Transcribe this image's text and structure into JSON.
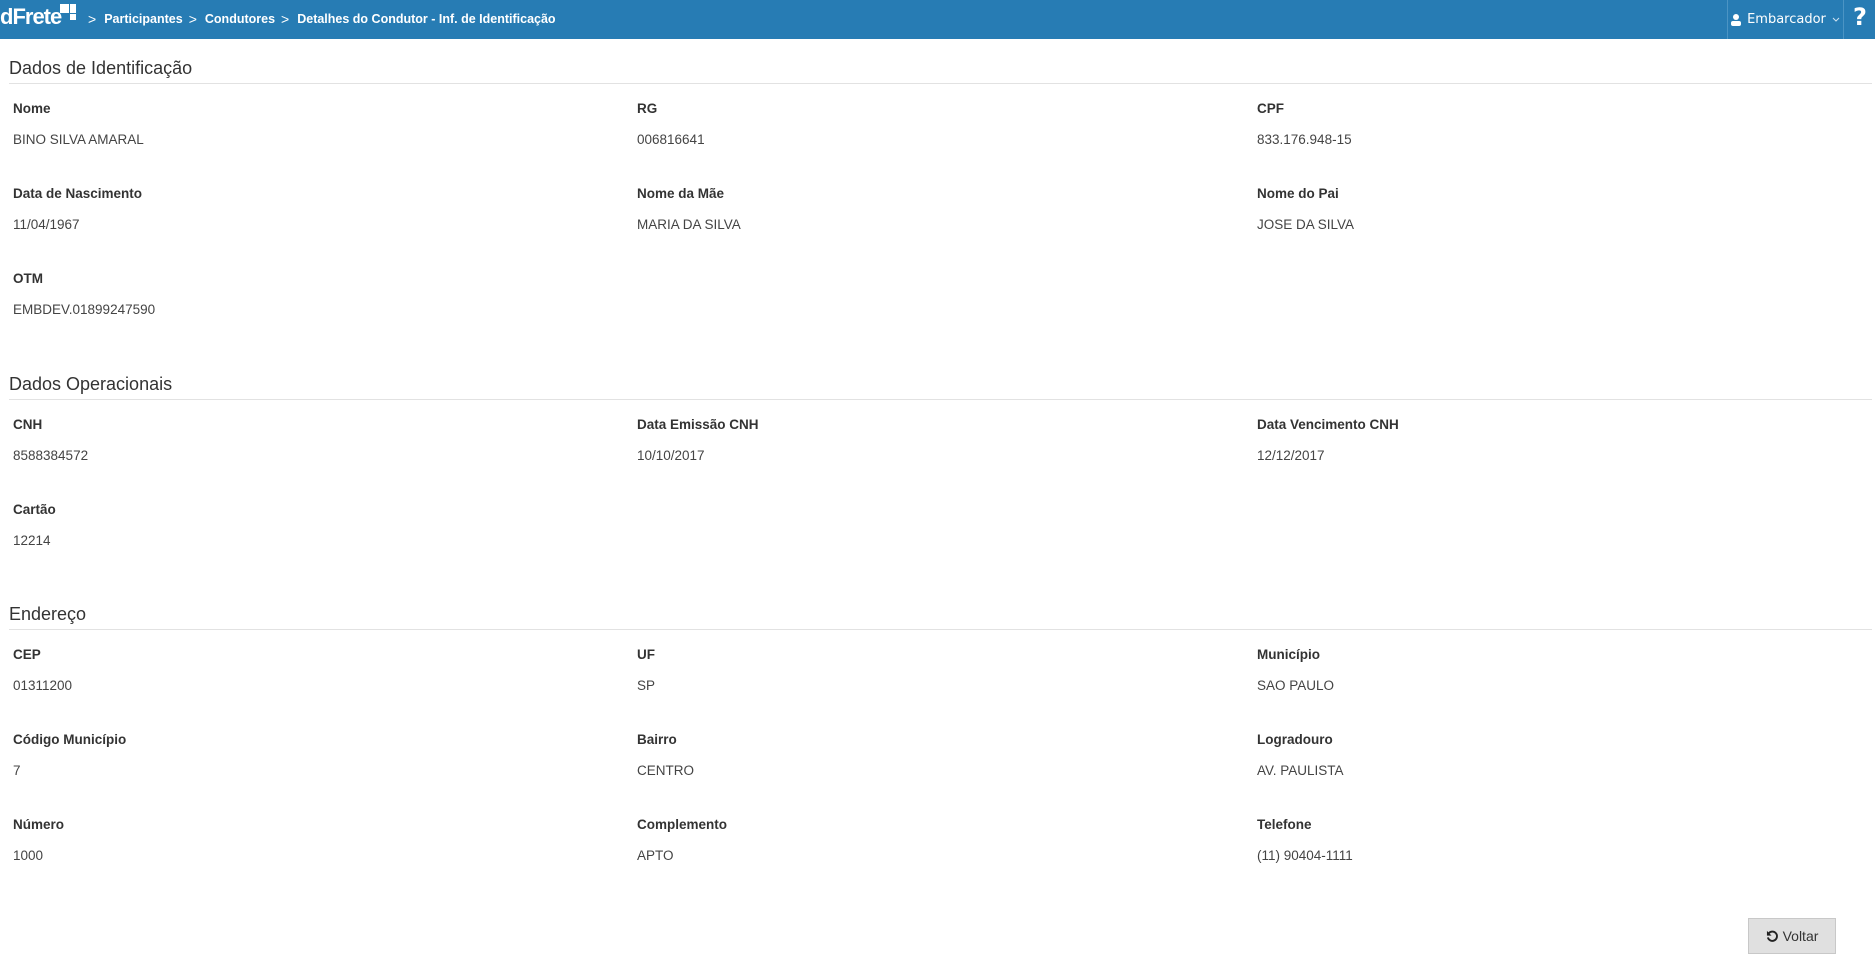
{
  "header": {
    "logo": "dFrete",
    "breadcrumb": [
      "Participantes",
      "Condutores",
      "Detalhes do Condutor - Inf. de Identificação"
    ],
    "user": "Embarcador",
    "help": "?",
    "color": "#277cb4"
  },
  "sections": [
    {
      "title": "Dados de Identificação",
      "fields": [
        {
          "label": "Nome",
          "value": "BINO SILVA AMARAL"
        },
        {
          "label": "RG",
          "value": "006816641"
        },
        {
          "label": "CPF",
          "value": "833.176.948-15"
        },
        {
          "label": "Data de Nascimento",
          "value": "11/04/1967"
        },
        {
          "label": "Nome da Mãe",
          "value": "MARIA DA SILVA"
        },
        {
          "label": "Nome do Pai",
          "value": "JOSE DA SILVA"
        },
        {
          "label": "OTM",
          "value": "EMBDEV.01899247590"
        }
      ]
    },
    {
      "title": "Dados Operacionais",
      "fields": [
        {
          "label": "CNH",
          "value": "8588384572"
        },
        {
          "label": "Data Emissão CNH",
          "value": "10/10/2017"
        },
        {
          "label": "Data Vencimento CNH",
          "value": "12/12/2017"
        },
        {
          "label": "Cartão",
          "value": "12214"
        }
      ]
    },
    {
      "title": "Endereço",
      "fields": [
        {
          "label": "CEP",
          "value": "01311200"
        },
        {
          "label": "UF",
          "value": "SP"
        },
        {
          "label": "Município",
          "value": "SAO PAULO"
        },
        {
          "label": "Código Município",
          "value": "7"
        },
        {
          "label": "Bairro",
          "value": "CENTRO"
        },
        {
          "label": "Logradouro",
          "value": "AV. PAULISTA"
        },
        {
          "label": "Número",
          "value": "1000"
        },
        {
          "label": "Complemento",
          "value": "APTO"
        },
        {
          "label": "Telefone",
          "value": "(11) 90404-1111"
        }
      ]
    }
  ],
  "actions": {
    "back": "Voltar",
    "back_icon": "undo-icon"
  }
}
